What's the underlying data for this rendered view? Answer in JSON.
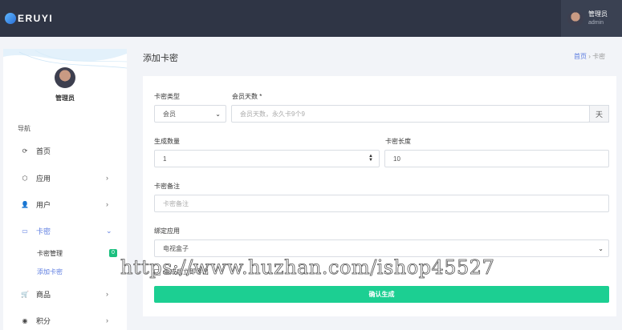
{
  "header": {
    "logo_text": "ERUYI",
    "user_name": "管理员",
    "user_account": "admin"
  },
  "sidebar": {
    "user_name": "管理员",
    "nav_title": "导航",
    "items": [
      {
        "label": "首页",
        "icon": "home-icon",
        "glyph": "⟳"
      },
      {
        "label": "应用",
        "icon": "app-icon",
        "glyph": "⬡",
        "arrow": "›"
      },
      {
        "label": "用户",
        "icon": "user-icon",
        "glyph": "👤",
        "arrow": "›"
      },
      {
        "label": "卡密",
        "icon": "card-icon",
        "glyph": "▭",
        "arrow": "⌄"
      },
      {
        "label": "商品",
        "icon": "cart-icon",
        "glyph": "🛒",
        "arrow": "›"
      },
      {
        "label": "积分",
        "icon": "points-icon",
        "glyph": "◉",
        "arrow": "›"
      }
    ],
    "sub_items": [
      {
        "label": "卡密管理",
        "badge": "0"
      },
      {
        "label": "添加卡密"
      }
    ]
  },
  "page": {
    "title": "添加卡密",
    "breadcrumb_home": "首页",
    "breadcrumb_sep": "›",
    "breadcrumb_current": "卡密"
  },
  "form": {
    "card_type_label": "卡密类型",
    "card_type_value": "会员",
    "member_days_label": "会员天数 *",
    "member_days_placeholder": "会员天数，永久卡9个9",
    "member_days_unit": "天",
    "quantity_label": "生成数量",
    "quantity_value": "1",
    "length_label": "卡密长度",
    "length_value": "10",
    "note_label": "卡密备注",
    "note_placeholder": "卡密备注",
    "bind_app_label": "绑定应用",
    "bind_app_value": "电视盒子",
    "export_label": "生成后立即导出",
    "submit_label": "确认生成"
  },
  "watermark": "https://www.huzhan.com/ishop45527",
  "colors": {
    "topbar": "#2f3545",
    "accent": "#5b7be0",
    "submit": "#1ccf92",
    "badge": "#1bbf7e"
  }
}
